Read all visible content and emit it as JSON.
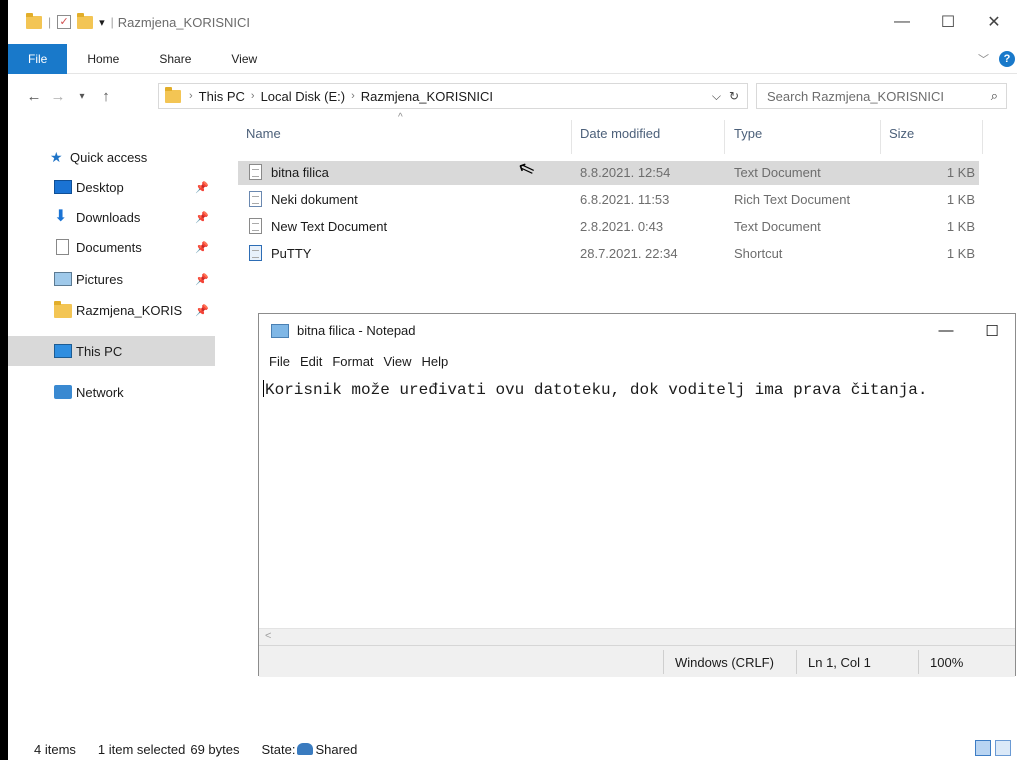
{
  "explorer": {
    "title": "Razmjena_KORISNICI",
    "ribbon_tabs": [
      "File",
      "Home",
      "Share",
      "View"
    ],
    "breadcrumb": [
      "This PC",
      "Local Disk (E:)",
      "Razmjena_KORISNICI"
    ],
    "search_placeholder": "Search Razmjena_KORISNICI",
    "nav": {
      "quick_access": "Quick access",
      "desktop": "Desktop",
      "downloads": "Downloads",
      "documents": "Documents",
      "pictures": "Pictures",
      "razmjena": "Razmjena_KORIS",
      "this_pc": "This PC",
      "network": "Network"
    },
    "columns": [
      "Name",
      "Date modified",
      "Type",
      "Size"
    ],
    "files": [
      {
        "name": "bitna filica",
        "date": "8.8.2021. 12:54",
        "type": "Text Document",
        "size": "1 KB"
      },
      {
        "name": "Neki dokument",
        "date": "6.8.2021. 11:53",
        "type": "Rich Text Document",
        "size": "1 KB"
      },
      {
        "name": "New Text Document",
        "date": "2.8.2021. 0:43",
        "type": "Text Document",
        "size": "1 KB"
      },
      {
        "name": "PuTTY",
        "date": "28.7.2021. 22:34",
        "type": "Shortcut",
        "size": "1 KB"
      }
    ],
    "status": {
      "items": "4 items",
      "selected": "1 item selected",
      "bytes": "69 bytes",
      "state_label": "State:",
      "state_value": "Shared"
    }
  },
  "notepad": {
    "title": "bitna filica - Notepad",
    "menu": [
      "File",
      "Edit",
      "Format",
      "View",
      "Help"
    ],
    "content": "Korisnik može uređivati ovu datoteku, dok voditelj ima prava čitanja.",
    "status": {
      "line_ending": "Windows (CRLF)",
      "position": "Ln 1, Col 1",
      "zoom": "100%"
    }
  }
}
